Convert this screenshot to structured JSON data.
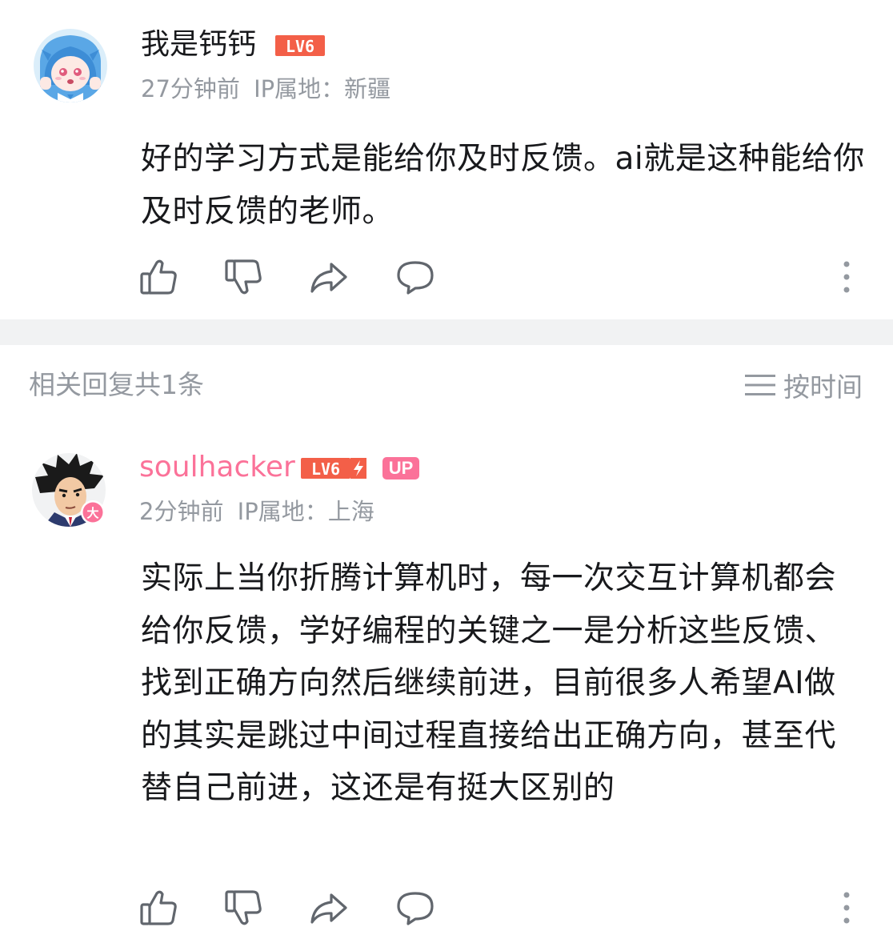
{
  "comment1": {
    "username": "我是钙钙",
    "level": "LV6",
    "time": "27分钟前",
    "ip_label": "IP属地：",
    "ip_location": "新疆",
    "content": "好的学习方式是能给你及时反馈。ai就是这种能给你及时反馈的老师。"
  },
  "replies_header": {
    "label": "相关回复共1条",
    "sort_label": "按时间"
  },
  "comment2": {
    "username": "soulhacker",
    "level": "LV6",
    "up_badge": "UP",
    "avatar_badge": "大",
    "time": "2分钟前",
    "ip_label": "IP属地：",
    "ip_location": "上海",
    "content": "实际上当你折腾计算机时，每一次交互计算机都会给你反馈，学好编程的关键之一是分析这些反馈、找到正确方向然后继续前进，目前很多人希望AI做的其实是跳过中间过程直接给出正确方向，甚至代替自己前进，这还是有挺大区别的"
  },
  "colors": {
    "text": "#18191c",
    "muted": "#9499a0",
    "pink": "#fb7299",
    "level_red": "#f35f48",
    "divider": "#f1f2f3"
  },
  "icons": [
    "like-icon",
    "dislike-icon",
    "share-icon",
    "reply-icon",
    "more-icon",
    "sort-icon"
  ]
}
